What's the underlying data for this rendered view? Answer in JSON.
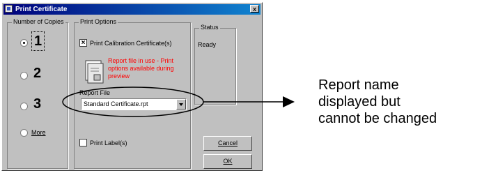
{
  "window": {
    "title": "Print Certificate",
    "close_label": "x"
  },
  "copies": {
    "legend": "Number of Copies",
    "options": [
      {
        "label": "1",
        "selected": true
      },
      {
        "label": "2",
        "selected": false
      },
      {
        "label": "3",
        "selected": false
      },
      {
        "label": "More",
        "selected": false
      }
    ]
  },
  "print_options": {
    "legend": "Print Options",
    "calibration_label": "Print Calibration Certificate(s)",
    "calibration_checked": true,
    "warning": "Report file in use - Print options available during preview",
    "report_file_label": "Report File",
    "report_file_value": "Standard Certificate.rpt",
    "labels_label": "Print Label(s)",
    "labels_checked": false
  },
  "status": {
    "legend": "Status",
    "value": "Ready"
  },
  "buttons": {
    "cancel": "Cancel",
    "ok": "OK"
  },
  "annotation": {
    "line1": "Report name",
    "line2": "displayed but",
    "line3": "cannot be changed"
  },
  "colors": {
    "title_start": "#00007b",
    "title_end": "#1084d0",
    "dialog_bg": "#c0c0c0",
    "warning": "#ff0000"
  }
}
